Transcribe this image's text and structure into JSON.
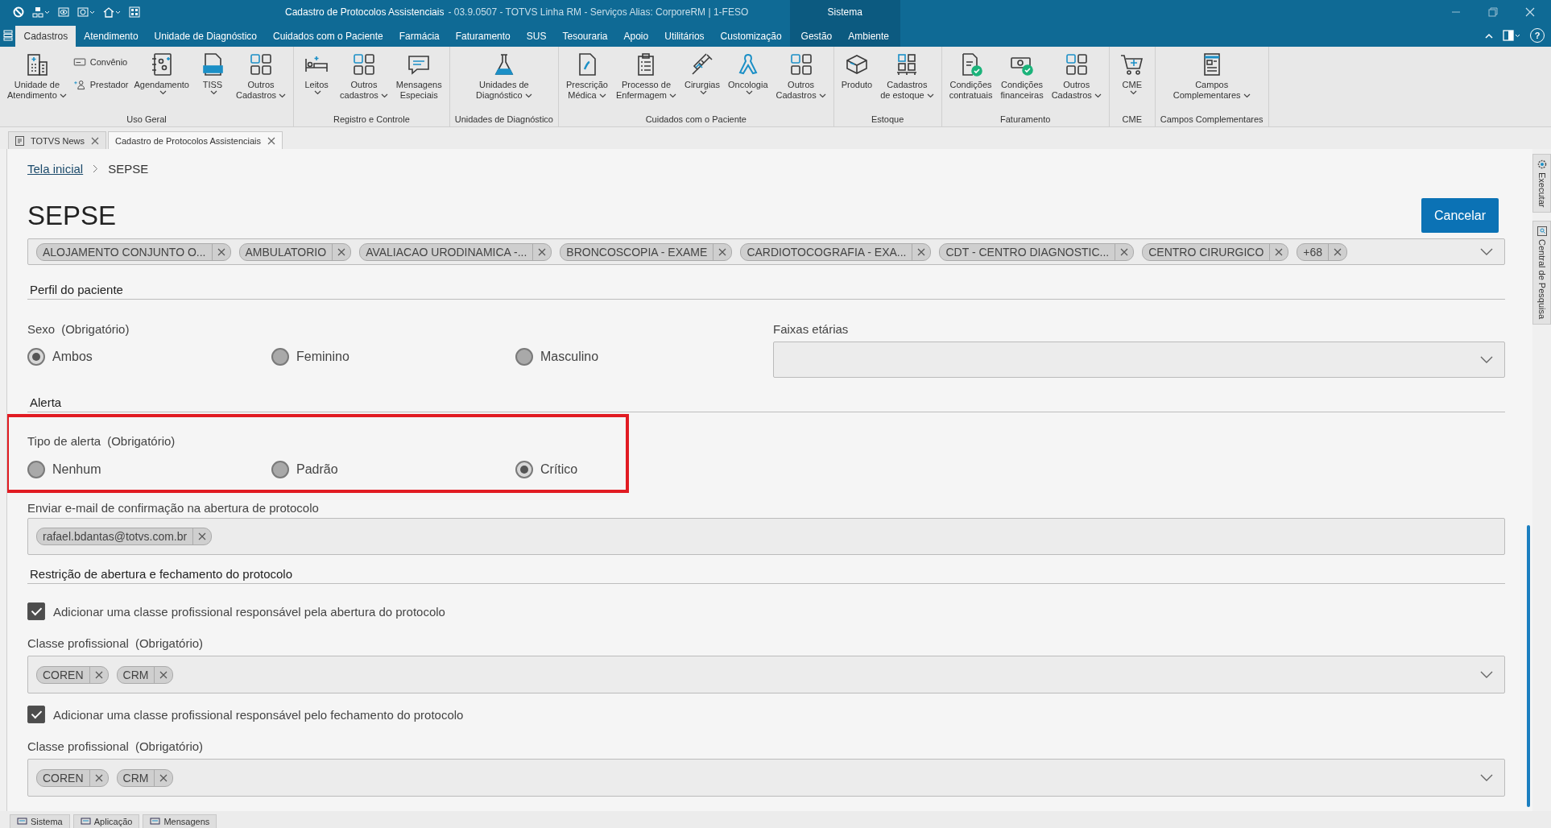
{
  "window": {
    "title": "Cadastro de Protocolos Assistenciais",
    "subtitle": "- 03.9.0507 - TOTVS Linha RM - Serviços  Alias: CorporeRM | 1-FESO"
  },
  "menu": {
    "tabs": [
      {
        "label": "Cadastros",
        "selected": true
      },
      {
        "label": "Atendimento",
        "selected": false
      },
      {
        "label": "Unidade de Diagnóstico",
        "selected": false
      },
      {
        "label": "Cuidados com o Paciente",
        "selected": false
      },
      {
        "label": "Farmácia",
        "selected": false
      },
      {
        "label": "Faturamento",
        "selected": false
      },
      {
        "label": "SUS",
        "selected": false
      },
      {
        "label": "Tesouraria",
        "selected": false
      },
      {
        "label": "Apoio",
        "selected": false
      },
      {
        "label": "Utilitários",
        "selected": false
      },
      {
        "label": "Customização",
        "selected": false
      }
    ],
    "context": {
      "label": "Sistema",
      "tabs": [
        {
          "label": "Gestão",
          "selected": false
        },
        {
          "label": "Ambiente",
          "selected": false
        }
      ]
    },
    "help": "?"
  },
  "ribbon": {
    "groups": [
      {
        "label": "Uso Geral",
        "items": [
          {
            "label": "Unidade de\nAtendimento",
            "kind": "large",
            "dropdown": true
          },
          {
            "label": "Convênio",
            "kind": "small",
            "dropdown": false
          },
          {
            "label": "Prestador",
            "kind": "small",
            "dropdown": false
          },
          {
            "label": "Agendamento",
            "kind": "large",
            "dropdown": true
          },
          {
            "label": "TISS",
            "kind": "large",
            "dropdown": true
          },
          {
            "label": "Outros\nCadastros",
            "kind": "large",
            "dropdown": true
          }
        ]
      },
      {
        "label": "Registro e Controle",
        "items": [
          {
            "label": "Leitos",
            "kind": "large",
            "dropdown": true
          },
          {
            "label": "Outros\ncadastros",
            "kind": "large",
            "dropdown": true
          },
          {
            "label": "Mensagens\nEspeciais",
            "kind": "large",
            "dropdown": false
          }
        ]
      },
      {
        "label": "Unidades de Diagnóstico",
        "items": [
          {
            "label": "Unidades de\nDiagnóstico",
            "kind": "large",
            "dropdown": true
          }
        ]
      },
      {
        "label": "Cuidados com o Paciente",
        "items": [
          {
            "label": "Prescrição\nMédica",
            "kind": "large",
            "dropdown": true
          },
          {
            "label": "Processo de\nEnfermagem",
            "kind": "large",
            "dropdown": true
          },
          {
            "label": "Cirurgias",
            "kind": "large",
            "dropdown": true
          },
          {
            "label": "Oncologia",
            "kind": "large",
            "dropdown": true
          },
          {
            "label": "Outros\nCadastros",
            "kind": "large",
            "dropdown": true
          }
        ]
      },
      {
        "label": "Estoque",
        "items": [
          {
            "label": "Produto",
            "kind": "large",
            "dropdown": false
          },
          {
            "label": "Cadastros\nde estoque",
            "kind": "large",
            "dropdown": true
          }
        ]
      },
      {
        "label": "Faturamento",
        "items": [
          {
            "label": "Condições\ncontratuais",
            "kind": "large",
            "dropdown": false
          },
          {
            "label": "Condições\nfinanceiras",
            "kind": "large",
            "dropdown": false
          },
          {
            "label": "Outros\nCadastros",
            "kind": "large",
            "dropdown": true
          }
        ]
      },
      {
        "label": "CME",
        "items": [
          {
            "label": "CME",
            "kind": "large",
            "dropdown": true
          }
        ]
      },
      {
        "label": "Campos Complementares",
        "items": [
          {
            "label": "Campos\nComplementares",
            "kind": "large",
            "dropdown": true
          }
        ]
      }
    ]
  },
  "doc_tabs": [
    {
      "label": "TOTVS News",
      "selected": false
    },
    {
      "label": "Cadastro de Protocolos Assistenciais",
      "selected": true
    }
  ],
  "breadcrumb": {
    "link": "Tela inicial",
    "current": "SEPSE"
  },
  "page": {
    "title": "SEPSE",
    "cancel_button": "Cancelar"
  },
  "units_field": {
    "tags": [
      "ALOJAMENTO CONJUNTO O...",
      "AMBULATORIO",
      "AVALIACAO URODINAMICA -...",
      "BRONCOSCOPIA - EXAME",
      "CARDIOTOCOGRAFIA - EXA...",
      "CDT - CENTRO DIAGNOSTIC...",
      "CENTRO CIRURGICO",
      "+68"
    ]
  },
  "patient_profile": {
    "heading": "Perfil do paciente",
    "sex": {
      "label": "Sexo",
      "note": "(Obrigatório)",
      "options": [
        {
          "label": "Ambos",
          "selected": true
        },
        {
          "label": "Feminino",
          "selected": false
        },
        {
          "label": "Masculino",
          "selected": false
        }
      ]
    },
    "age_ranges": {
      "label": "Faixas etárias"
    }
  },
  "alert": {
    "heading": "Alerta",
    "type": {
      "label": "Tipo de alerta",
      "note": "(Obrigatório)",
      "highlighted": true,
      "options": [
        {
          "label": "Nenhum",
          "selected": false
        },
        {
          "label": "Padrão",
          "selected": false
        },
        {
          "label": "Crítico",
          "selected": true
        }
      ]
    },
    "email": {
      "label": "Enviar e-mail de confirmação na abertura de protocolo",
      "tags": [
        "rafael.bdantas@totvs.com.br"
      ]
    }
  },
  "restriction": {
    "heading": "Restrição de abertura e fechamento do protocolo",
    "rules": [
      {
        "label": "Adicionar uma classe profissional responsável pela abertura do protocolo",
        "checked": true,
        "field_label": "Classe profissional",
        "note": "(Obrigatório)",
        "tags": [
          "COREN",
          "CRM"
        ]
      },
      {
        "label": "Adicionar uma classe profissional responsável pelo fechamento do protocolo",
        "checked": true,
        "field_label": "Classe profissional",
        "note": "(Obrigatório)",
        "tags": [
          "COREN",
          "CRM"
        ]
      }
    ]
  },
  "side_panel": [
    "Executar",
    "Central de Pesquisa"
  ],
  "status_tabs": [
    "Sistema",
    "Aplicação",
    "Mensagens"
  ]
}
